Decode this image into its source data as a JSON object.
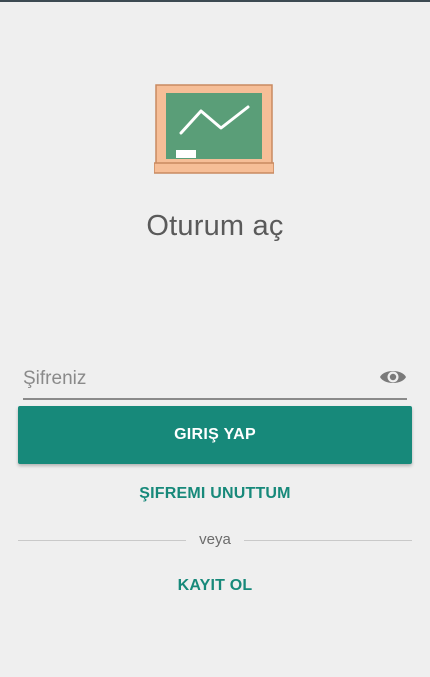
{
  "header": {
    "title": "Oturum aç",
    "logo_icon": "chalkboard-icon"
  },
  "form": {
    "password_placeholder": "Şifreniz",
    "password_value": "",
    "visibility_icon": "eye-icon",
    "login_label": "GIRIŞ YAP",
    "forgot_label": "ŞIFREMI UNUTTUM",
    "divider_label": "veya",
    "register_label": "KAYIT OL"
  },
  "colors": {
    "primary": "#17897a",
    "background": "#efefef",
    "board_green": "#5a9e78",
    "board_frame": "#f6be97"
  }
}
